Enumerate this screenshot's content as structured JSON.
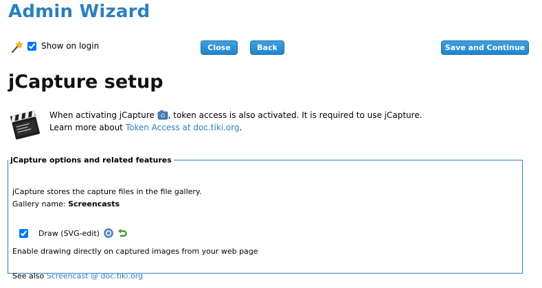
{
  "wizard": {
    "title": "Admin Wizard"
  },
  "topbar": {
    "show_on_login_label": "Show on login",
    "show_on_login_checked": true,
    "close_label": "Close",
    "back_label": "Back",
    "save_label": "Save and Continue"
  },
  "section": {
    "title": "jCapture setup",
    "intro_before_icon": "When activating jCapture",
    "intro_after_icon": ", token access is also activated. It is required to use jCapture.",
    "learn_more_prefix": "Learn more about",
    "learn_more_link": "Token Access at doc.tiki.org",
    "learn_more_suffix": "."
  },
  "options": {
    "legend": "jCapture options and related features",
    "stores_text": "jCapture stores the capture files in the file gallery.",
    "gallery_label": "Gallery name:",
    "gallery_name": "Screencasts",
    "draw_label": "Draw (SVG-edit)",
    "draw_checked": true,
    "draw_description": "Enable drawing directly on captured images from your web page",
    "see_also_prefix": "See also",
    "see_also_link": "Screencast @ doc.tiki.org"
  },
  "colors": {
    "accent": "#2a7fc0",
    "button": "#2b8fd6"
  },
  "icons": [
    "wand-icon",
    "clapperboard-icon",
    "camera-icon",
    "help-icon",
    "undo-icon"
  ]
}
